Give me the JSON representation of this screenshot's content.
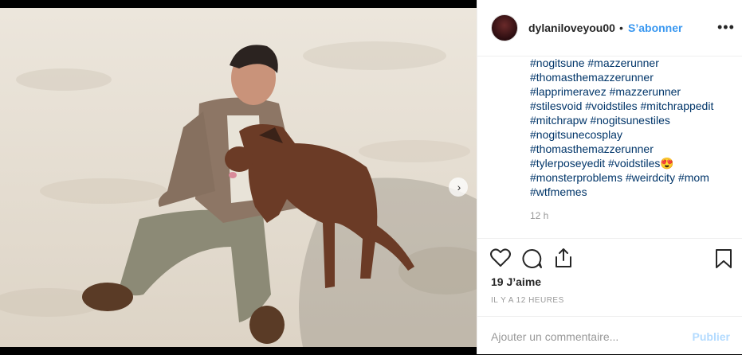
{
  "post": {
    "username": "dylaniloveyou00",
    "separator": "•",
    "follow_label": "S’abonner",
    "more_label": "•••",
    "caption_lines": [
      "#nogitsune #mazzerunner",
      "#thomasthemazzerunner",
      "#lapprimeravez #mazzerunner",
      "#stilesvoid #voidstiles #mitchrappedit",
      "#mitchrapw #nogitsunestiles",
      "#nogitsunecosplay",
      "#thomasthemazzerunner",
      "#tylerposeyedit #voidstiles😍",
      "#monsterproblems #weirdcity #mom",
      "#wtfmemes"
    ],
    "time_ago": "12 h",
    "likes": "19 J’aime",
    "time_ago_full": "IL Y A 12 HEURES"
  },
  "actions": {
    "like_icon": "heart-icon",
    "comment_icon": "comment-icon",
    "share_icon": "share-icon",
    "save_icon": "bookmark-icon"
  },
  "comment": {
    "placeholder": "Ajouter un commentaire...",
    "publish_label": "Publier"
  },
  "colors": {
    "link": "#003569",
    "follow": "#3897f0",
    "publish_disabled": "#b3dbff"
  }
}
